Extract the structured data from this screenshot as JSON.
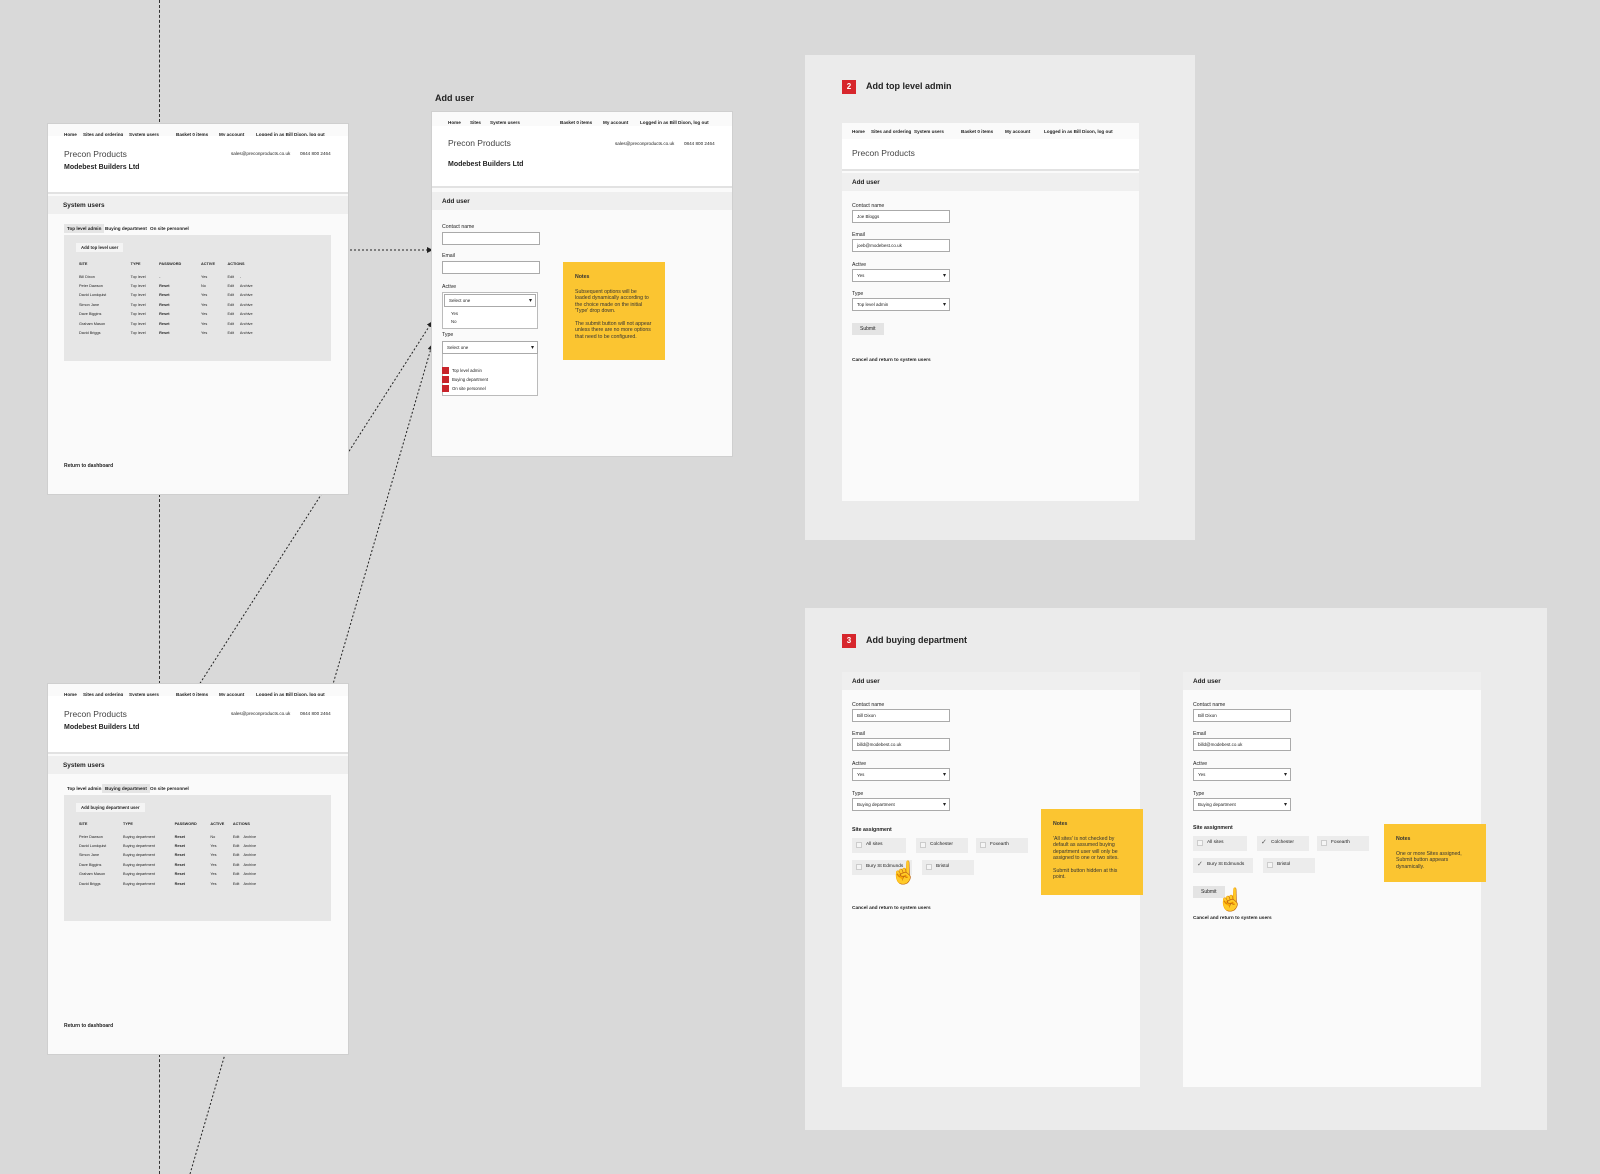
{
  "nav_left": {
    "home": "Home",
    "sites": "Sites and ordering",
    "system_users": "System users",
    "basket": "Basket 0 items",
    "account": "My account",
    "logged": "Logged in as Bill Dixon, log out"
  },
  "nav_mid": {
    "home": "Home",
    "sites": "Sites",
    "system_users": "System users",
    "basket": "Basket 0 items",
    "account": "My account",
    "logged": "Logged in as Bill Dixon, log out"
  },
  "brand": "Precon Products",
  "company": "Modebest Builders Ltd",
  "contact_email": "sales@preconproducts.co.uk",
  "contact_phone": "0844 800 2464",
  "system_users_title": "System users",
  "tabs": [
    "Top level admin",
    "Buying department",
    "On site personnel"
  ],
  "return_dashboard": "Return to dashboard",
  "table_headers": [
    "SITE",
    "TYPE",
    "PASSWORD",
    "ACTIVE",
    "ACTIONS"
  ],
  "table_top": {
    "add_label": "Add top level user",
    "rows": [
      [
        "Bill Dixon",
        "Top level",
        "-",
        "Yes",
        "Edit",
        "-"
      ],
      [
        "Peter Dawson",
        "Top level",
        "Reset",
        "No",
        "Edit",
        "Archive"
      ],
      [
        "David Lundquist",
        "Top level",
        "Reset",
        "Yes",
        "Edit",
        "Archive"
      ],
      [
        "Simon Jane",
        "Top level",
        "Reset",
        "Yes",
        "Edit",
        "Archive"
      ],
      [
        "Dave Biggins",
        "Top level",
        "Reset",
        "Yes",
        "Edit",
        "Archive"
      ],
      [
        "Graham Mason",
        "Top level",
        "Reset",
        "Yes",
        "Edit",
        "Archive"
      ],
      [
        "David Briggs",
        "Top level",
        "Reset",
        "Yes",
        "Edit",
        "Archive"
      ]
    ]
  },
  "table_buying": {
    "add_label": "Add buying department user",
    "rows": [
      [
        "Peter Dawson",
        "Buying department",
        "Reset",
        "No",
        "Edit",
        "Archive"
      ],
      [
        "David Lundquist",
        "Buying department",
        "Reset",
        "Yes",
        "Edit",
        "Archive"
      ],
      [
        "Simon Jane",
        "Buying department",
        "Reset",
        "Yes",
        "Edit",
        "Archive"
      ],
      [
        "Dave Biggins",
        "Buying department",
        "Reset",
        "Yes",
        "Edit",
        "Archive"
      ],
      [
        "Graham Mason",
        "Buying department",
        "Reset",
        "Yes",
        "Edit",
        "Archive"
      ],
      [
        "David Briggs",
        "Buying department",
        "Reset",
        "Yes",
        "Edit",
        "Archive"
      ]
    ]
  },
  "add_user_heading": "Add user",
  "form": {
    "contact_label": "Contact name",
    "email_label": "Email",
    "active_label": "Active",
    "type_label": "Type",
    "select_placeholder": "Select one",
    "select_placeholder2": "Select one",
    "active_options": [
      "Yes",
      "No"
    ],
    "type_options": [
      "Top level admin",
      "Buying department",
      "On site personnel"
    ],
    "submit": "Submit",
    "cancel": "Cancel and return to system users",
    "site_assignment": "Site assignment"
  },
  "note1": {
    "title": "Notes",
    "p1": "Subsequent options will be loaded dynamically according to the choice made on the initial 'Type' drop down.",
    "p2": "The submit button will not appear unless there are no more options that need to be configured."
  },
  "section2": {
    "num": "2",
    "title": "Add top level admin",
    "name": "Joe Bloggs",
    "email": "joeb@modebest.co.uk",
    "active": "Yes",
    "type": "Top level admin"
  },
  "section3": {
    "num": "3",
    "title": "Add buying department",
    "name": "Bill Dixon",
    "email": "billd@modebest.co.uk",
    "active": "Yes",
    "type": "Buying department",
    "sites": [
      "All sites",
      "Colchester",
      "Foxearth",
      "Bury St Edmunds",
      "Bristol"
    ]
  },
  "note2": {
    "title": "Notes",
    "p1": "'All sites' is not checked by default as assumed buying department user will only be assigned to one or two sites.",
    "p2": "Submit button hidden at this point."
  },
  "note3": {
    "title": "Notes",
    "p1": "One or more Sites assigned, Submit button appears dynamically."
  },
  "colors": {
    "background": "#d9d9d9",
    "note": "#fbc531",
    "badge": "#d7262c"
  },
  "icons": [
    "hand-pointer-icon",
    "check-icon",
    "caret-down-icon"
  ]
}
